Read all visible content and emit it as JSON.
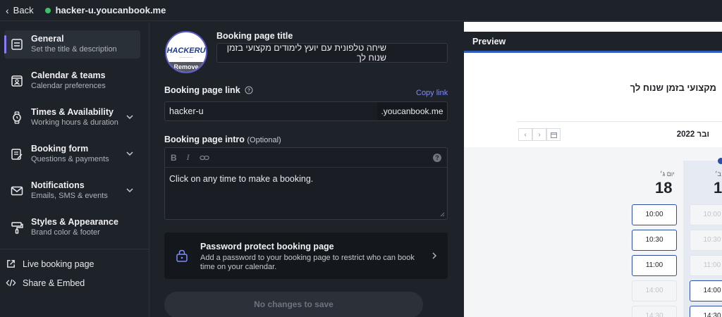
{
  "topbar": {
    "back_label": "Back",
    "domain": "hacker-u.youcanbook.me"
  },
  "sidebar": {
    "items": [
      {
        "title": "General",
        "subtitle": "Set the title & description"
      },
      {
        "title": "Calendar & teams",
        "subtitle": "Calendar preferences"
      },
      {
        "title": "Times & Availability",
        "subtitle": "Working hours & duration"
      },
      {
        "title": "Booking form",
        "subtitle": "Questions & payments"
      },
      {
        "title": "Notifications",
        "subtitle": "Emails, SMS & events"
      },
      {
        "title": "Styles & Appearance",
        "subtitle": "Brand color & footer"
      }
    ],
    "links": [
      {
        "label": "Live booking page"
      },
      {
        "label": "Share & Embed"
      }
    ]
  },
  "main": {
    "avatar": {
      "logo_text": "HACKERU",
      "remove_label": "Remove"
    },
    "title_label": "Booking page title",
    "title_value": "שיחה טלפונית עם יועץ לימודים מקצועי בזמן שנוח לך",
    "link_label": "Booking page link",
    "copy_link": "Copy link",
    "link_value": "hacker-u",
    "link_suffix": ".youcanbook.me",
    "intro_label": "Booking page intro",
    "intro_optional": "(Optional)",
    "toolbar": {
      "bold": "B",
      "italic": "I"
    },
    "intro_value": "Click on any time to make a booking.",
    "password": {
      "title": "Password protect booking page",
      "description": "Add a password to your booking page to restrict who can book time on your calendar."
    },
    "save_label": "No changes to save"
  },
  "preview": {
    "header": "Preview",
    "page_title": "מקצועי בזמן שנוח לך",
    "month": "ובר 2022",
    "days": [
      {
        "label": "יום ג׳",
        "number": "18"
      },
      {
        "label": "ב׳",
        "number": "1"
      }
    ],
    "col1_slots": [
      "10:00",
      "10:30",
      "11:00",
      "14:00",
      "14:30"
    ],
    "col2_slots": [
      "10:00",
      "10:30",
      "11:00",
      "14:00",
      "14:30"
    ]
  },
  "colors": {
    "accent": "#8b7cf6",
    "link": "#7d8cff",
    "slot_border": "#2c4ea8",
    "status_green": "#3cc26a"
  }
}
